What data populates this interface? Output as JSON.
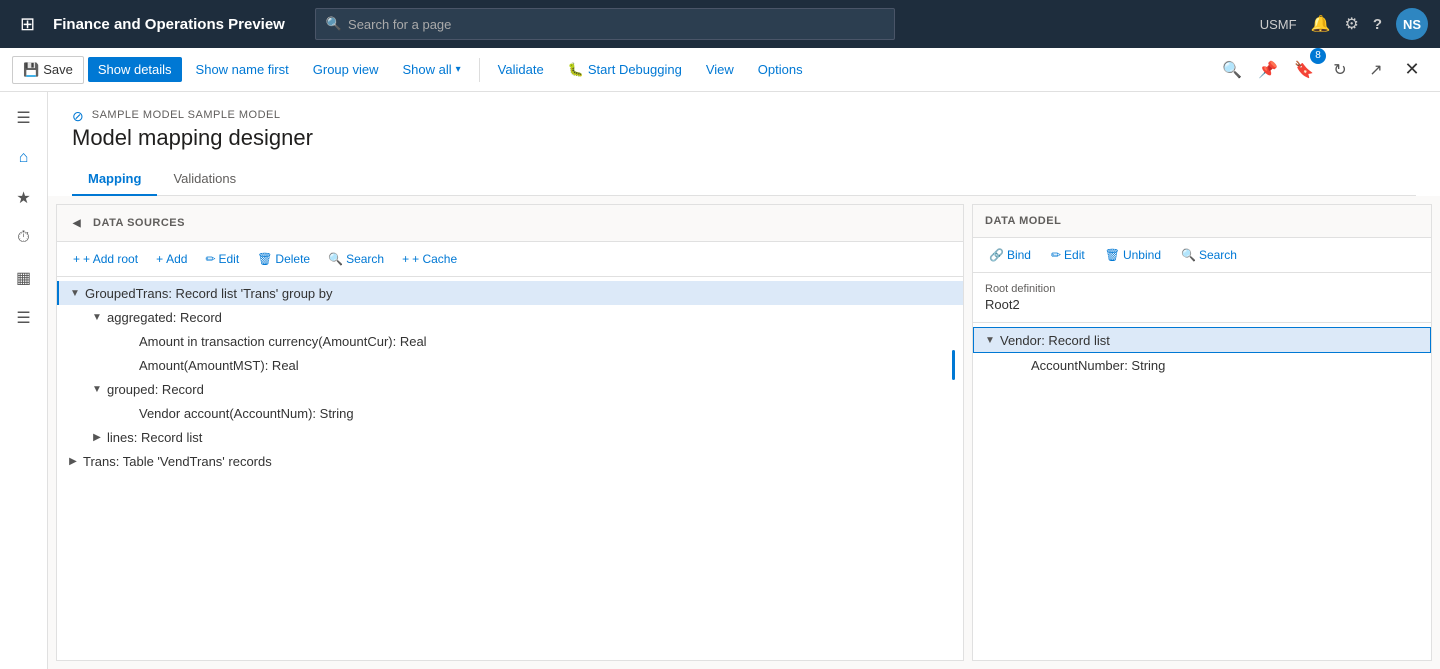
{
  "app": {
    "title": "Finance and Operations Preview"
  },
  "topnav": {
    "search_placeholder": "Search for a page",
    "user_code": "USMF",
    "avatar_initials": "NS"
  },
  "toolbar": {
    "save_label": "Save",
    "show_details_label": "Show details",
    "show_name_first_label": "Show name first",
    "group_view_label": "Group view",
    "show_all_label": "Show all",
    "validate_label": "Validate",
    "start_debugging_label": "Start Debugging",
    "view_label": "View",
    "options_label": "Options"
  },
  "page": {
    "breadcrumb": "SAMPLE MODEL SAMPLE MODEL",
    "title": "Model mapping designer"
  },
  "tabs": [
    {
      "label": "Mapping",
      "active": true
    },
    {
      "label": "Validations",
      "active": false
    }
  ],
  "datasources": {
    "header": "DATA SOURCES",
    "toolbar": {
      "add_root": "+ Add root",
      "add": "+ Add",
      "edit": "Edit",
      "delete": "Delete",
      "search": "Search",
      "cache": "+ Cache"
    },
    "tree": [
      {
        "id": 1,
        "indent": 0,
        "expand": "collapse",
        "label": "GroupedTrans: Record list 'Trans' group by",
        "selected": true
      },
      {
        "id": 2,
        "indent": 1,
        "expand": "collapse",
        "label": "aggregated: Record"
      },
      {
        "id": 3,
        "indent": 2,
        "expand": "none",
        "label": "Amount in transaction currency(AmountCur): Real"
      },
      {
        "id": 4,
        "indent": 2,
        "expand": "none",
        "label": "Amount(AmountMST): Real",
        "has_indicator": true
      },
      {
        "id": 5,
        "indent": 1,
        "expand": "collapse",
        "label": "grouped: Record"
      },
      {
        "id": 6,
        "indent": 2,
        "expand": "none",
        "label": "Vendor account(AccountNum): String"
      },
      {
        "id": 7,
        "indent": 1,
        "expand": "expand",
        "label": "lines: Record list"
      },
      {
        "id": 8,
        "indent": 0,
        "expand": "expand",
        "label": "Trans: Table 'VendTrans' records"
      }
    ]
  },
  "datamodel": {
    "header": "DATA MODEL",
    "toolbar": {
      "bind": "Bind",
      "edit": "Edit",
      "unbind": "Unbind",
      "search": "Search"
    },
    "root_definition_label": "Root definition",
    "root_definition_value": "Root2",
    "tree": [
      {
        "id": 1,
        "indent": 0,
        "expand": "collapse",
        "label": "Vendor: Record list",
        "selected": true
      },
      {
        "id": 2,
        "indent": 1,
        "expand": "none",
        "label": "AccountNumber: String"
      }
    ]
  },
  "icons": {
    "grid": "⊞",
    "home": "⌂",
    "star": "★",
    "clock": "⏱",
    "table": "▦",
    "list": "☰",
    "bell": "🔔",
    "gear": "⚙",
    "question": "?",
    "search": "🔍",
    "filter": "⊘",
    "save": "💾",
    "link": "🔗",
    "edit_pencil": "✏",
    "trash": "🗑",
    "add_root": "+",
    "refresh": "↻",
    "external": "↗",
    "close": "✕",
    "expand_right": "▶",
    "collapse_down": "▼",
    "collapse_small": "▾",
    "bug": "🐛",
    "pin": "📌",
    "bookmark": "🔖",
    "notification_count": "8"
  }
}
